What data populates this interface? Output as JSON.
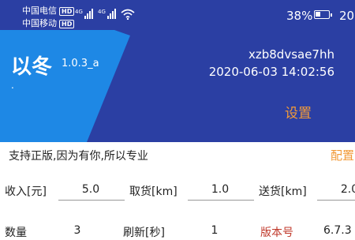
{
  "status_bar": {
    "carrier_1": "中国电信",
    "carrier_2": "中国移动",
    "hd_badge": "HD",
    "network_type": "4G",
    "battery_percent": "38%",
    "battery_level": 0.38,
    "clock": "20"
  },
  "header": {
    "app_name": "以冬",
    "version": "1.0.3_a",
    "dot": ".",
    "device_id": "xzb8dvsae7hh",
    "datetime": "2020-06-03 14:02:56",
    "settings_label": "设置"
  },
  "slogan": "支持正版,因为有你,所以专业",
  "config_label": "配置",
  "fields_row1": {
    "income_label": "收入[元]",
    "income_value": "5.0",
    "pickup_label": "取货[km]",
    "pickup_value": "1.0",
    "delivery_label": "送货[km]",
    "delivery_value": "2.0"
  },
  "fields_row2": {
    "quantity_label": "数量",
    "quantity_value": "3",
    "refresh_label": "刷新[秒]",
    "refresh_value": "1",
    "version_label": "版本号",
    "version_value": "6.7.3"
  },
  "colors": {
    "header_dark": "#2b3fa3",
    "header_light": "#1e88e5",
    "accent_orange": "#f29a38",
    "accent_red": "#c0392b"
  },
  "icons": [
    "signal-icon",
    "wifi-icon",
    "battery-icon"
  ]
}
